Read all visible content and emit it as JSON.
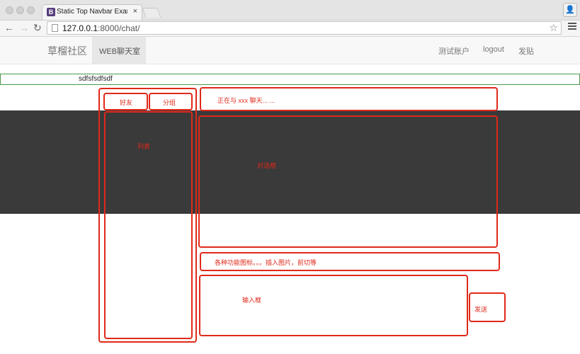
{
  "browser": {
    "tab_title": "Static Top Navbar Example",
    "tab_close": "×",
    "favicon_letter": "B",
    "url_host": "127.0.0.1",
    "url_rest": ":8000/chat/"
  },
  "navbar": {
    "brand": "草榴社区",
    "active_item": "WEB聊天室",
    "right_items": [
      "测试账户",
      "logout",
      "发贴"
    ]
  },
  "input_bar": {
    "value": "sdfsfsdfsdf"
  },
  "dark_band_text": "...",
  "wireframe": {
    "friends_tab": "好友",
    "groups_tab": "分组",
    "list_label": "列表",
    "chatting_with": "正在与 xxx 聊天... ...",
    "dialog_label": "对话框",
    "toolbar_label": "各种功能图标。。。插入图片，前切等",
    "input_label": "输入框",
    "send_label": "发送"
  },
  "colors": {
    "wireframe_red": "#e0291a",
    "input_green": "#4a9a4a",
    "dark_band": "#3a3a3a"
  }
}
